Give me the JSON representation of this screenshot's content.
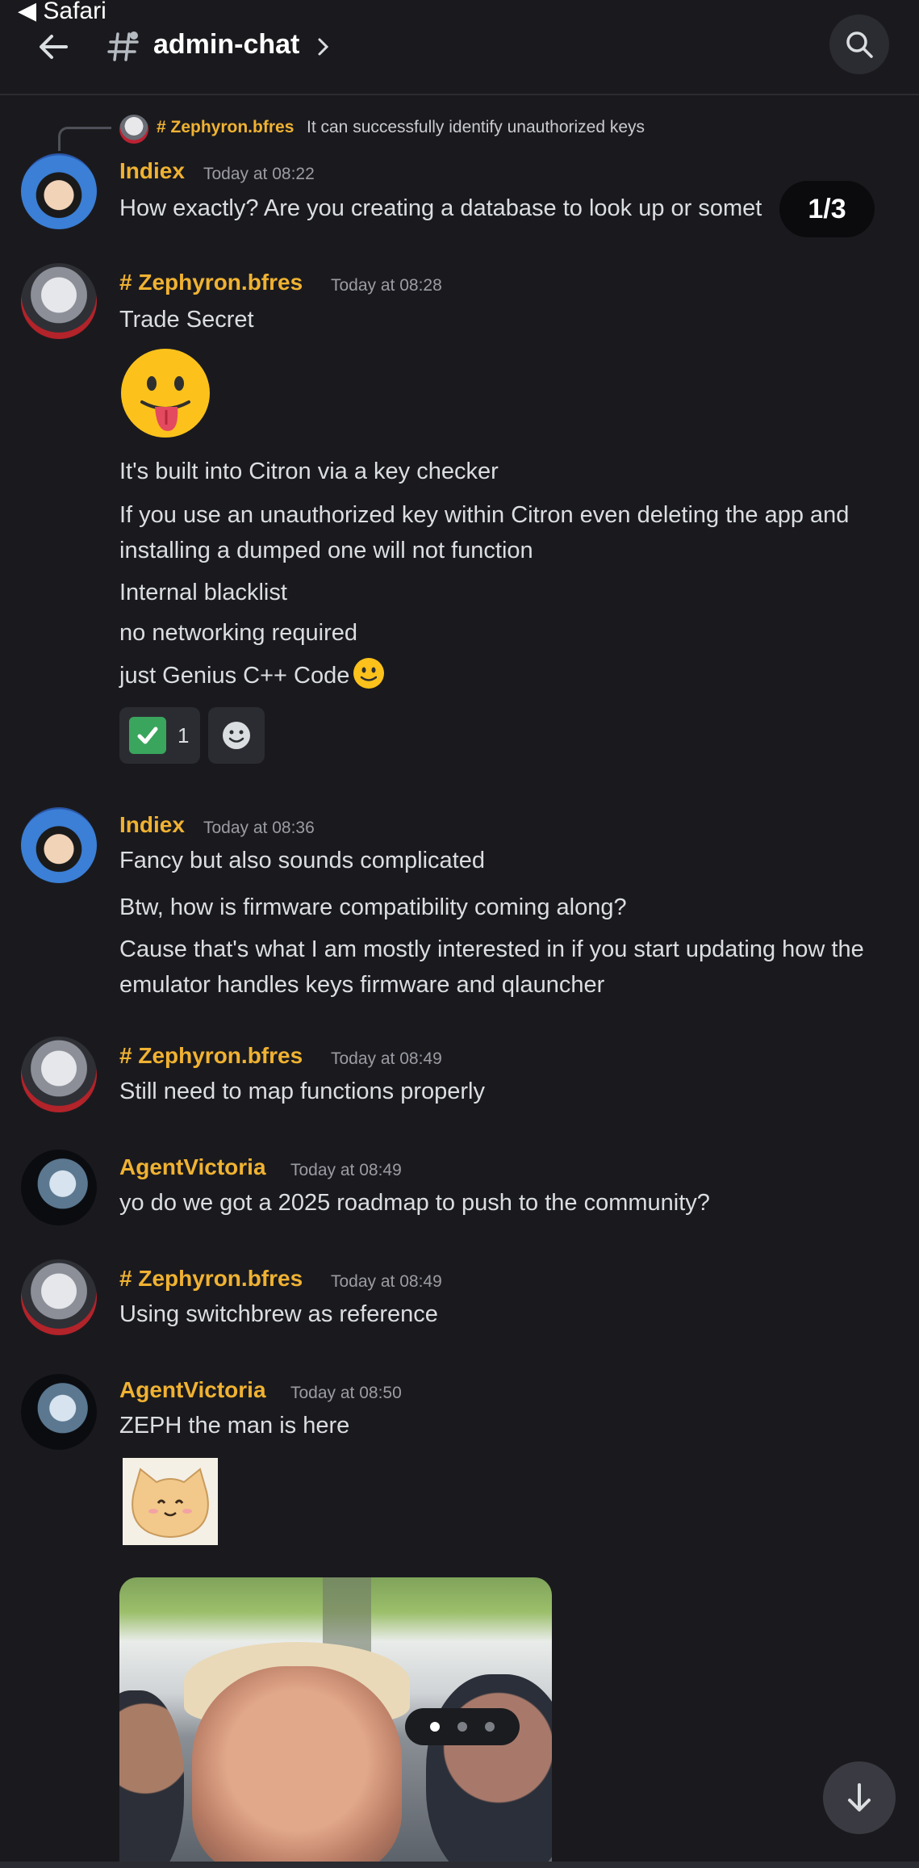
{
  "status": {
    "app": "◀ Safari"
  },
  "header": {
    "channel": "admin-chat"
  },
  "counter": "1/3",
  "reply": {
    "author": "# Zephyron.bfres",
    "text": "It can successfully identify unauthorized keys"
  },
  "messages": [
    {
      "author": "Indiex",
      "time": "Today at 08:22",
      "lines": [
        "How exactly? Are you creating a database to look up or somet"
      ]
    },
    {
      "author": "# Zephyron.bfres",
      "time": "Today at 08:28",
      "lines": [
        "Trade Secret",
        "It's built into Citron via a key checker",
        "If you use an unauthorized key within Citron even deleting the app and installing a dumped one will not function",
        "Internal blacklist",
        "no networking required",
        "just Genius C++ Code"
      ],
      "reaction_count": "1"
    },
    {
      "author": "Indiex",
      "time": "Today at 08:36",
      "lines": [
        "Fancy but also sounds complicated",
        "Btw, how is firmware compatibility coming along?",
        "Cause that's what I am mostly interested in if you start updating how the emulator handles keys firmware and qlauncher"
      ]
    },
    {
      "author": "# Zephyron.bfres",
      "time": "Today at 08:49",
      "lines": [
        "Still need to map functions properly"
      ]
    },
    {
      "author": "AgentVictoria",
      "time": "Today at 08:49",
      "lines": [
        "yo do we got a 2025 roadmap to push to the community?"
      ]
    },
    {
      "author": "# Zephyron.bfres",
      "time": "Today at 08:49",
      "lines": [
        "Using switchbrew as reference"
      ]
    },
    {
      "author": "AgentVictoria",
      "time": "Today at 08:50",
      "lines": [
        "ZEPH the man is here"
      ]
    }
  ],
  "colors": {
    "background": "#1a1a1e",
    "author": "#f0b232",
    "text": "#dbdee1",
    "timestamp": "#9b9ca3"
  },
  "icons": [
    "back-arrow-icon",
    "hashtag-icon",
    "chevron-right-icon",
    "search-icon",
    "check-mark-icon",
    "add-reaction-icon",
    "arrow-down-icon"
  ]
}
